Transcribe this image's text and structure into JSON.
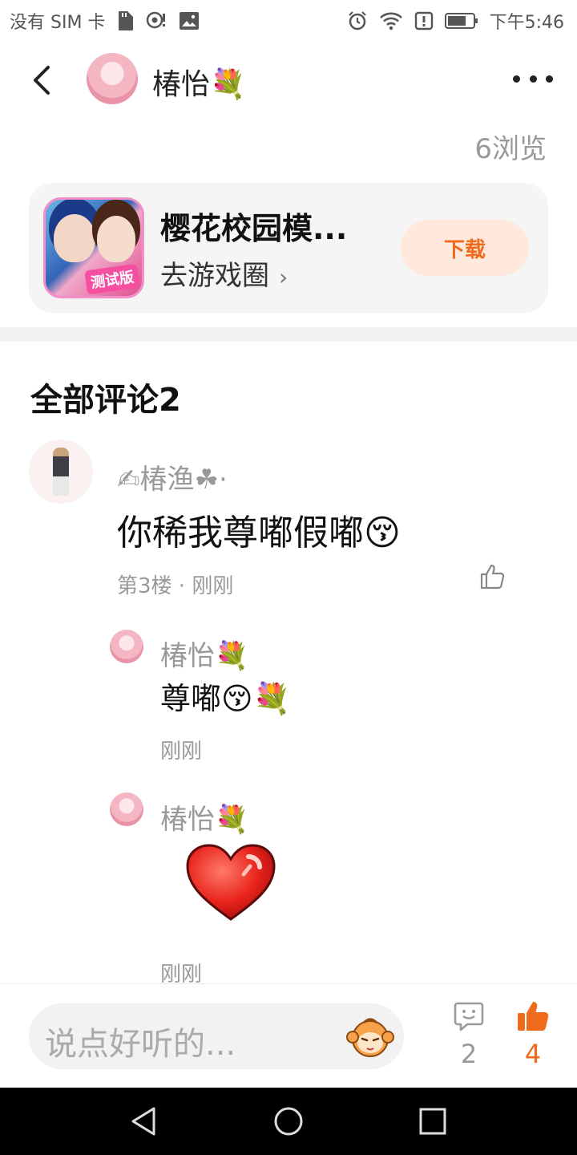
{
  "status_bar": {
    "carrier": "没有 SIM 卡",
    "time": "下午5:46"
  },
  "header": {
    "name": "椿怡💐"
  },
  "views": "6浏览",
  "game_card": {
    "title": "樱花校园模...",
    "badge": "测试版",
    "link_label": "去游戏圈",
    "link_chevron": "›",
    "download_label": "下载"
  },
  "comments": {
    "section_title": "全部评论2",
    "main": {
      "name": "✍椿渔☘·",
      "text": "你稀我尊嘟假嘟😚",
      "meta": "第3楼 · 刚刚"
    },
    "replies": [
      {
        "name": "椿怡💐",
        "text": "尊嘟😚💐",
        "time": "刚刚"
      },
      {
        "name": "椿怡💐",
        "text": "",
        "time": "刚刚"
      }
    ]
  },
  "bottom_bar": {
    "input_placeholder": "说点好听的...",
    "comment_count": "2",
    "like_count": "4"
  },
  "colors": {
    "accent": "#f06a1c",
    "download_bg": "#ffe8dc",
    "muted_text": "#999999"
  }
}
